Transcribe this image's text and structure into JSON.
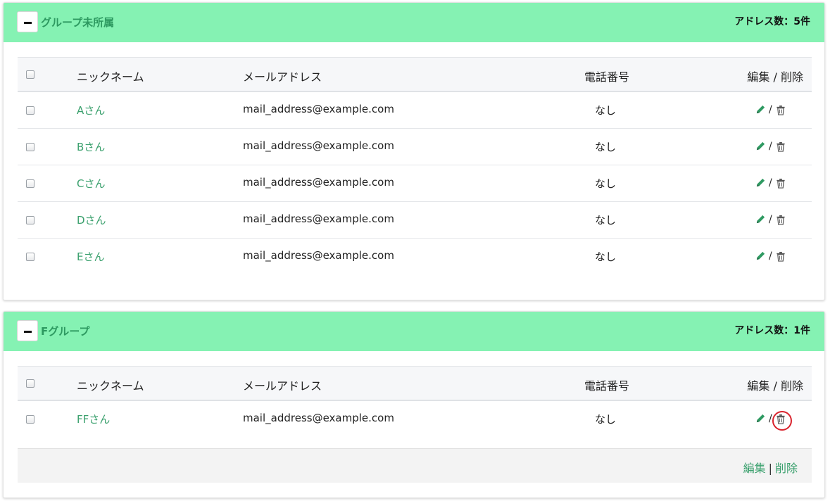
{
  "groups": [
    {
      "name": "グループ未所属",
      "count_label": "アドレス数：5件",
      "headers": {
        "nickname": "ニックネーム",
        "email": "メールアドレス",
        "phone": "電話番号",
        "ops": "編集 / 削除"
      },
      "rows": [
        {
          "nickname": "Aさん",
          "email": "mail_address@example.com",
          "phone": "なし"
        },
        {
          "nickname": "Bさん",
          "email": "mail_address@example.com",
          "phone": "なし"
        },
        {
          "nickname": "Cさん",
          "email": "mail_address@example.com",
          "phone": "なし"
        },
        {
          "nickname": "Dさん",
          "email": "mail_address@example.com",
          "phone": "なし"
        },
        {
          "nickname": "Eさん",
          "email": "mail_address@example.com",
          "phone": "なし"
        }
      ]
    },
    {
      "name": "Fグループ",
      "count_label": "アドレス数：1件",
      "headers": {
        "nickname": "ニックネーム",
        "email": "メールアドレス",
        "phone": "電話番号",
        "ops": "編集 / 削除"
      },
      "rows": [
        {
          "nickname": "FFさん",
          "email": "mail_address@example.com",
          "phone": "なし"
        }
      ],
      "footer": {
        "edit": "編集",
        "separator": "|",
        "delete": "削除"
      }
    }
  ],
  "ops_separator": "/",
  "icons": {
    "edit": "pencil-icon",
    "delete": "trash-icon",
    "collapse": "minus-icon"
  },
  "colors": {
    "header_bg": "#85f2b3",
    "accent": "#3aa06d",
    "highlight_ring": "#d9232d"
  }
}
